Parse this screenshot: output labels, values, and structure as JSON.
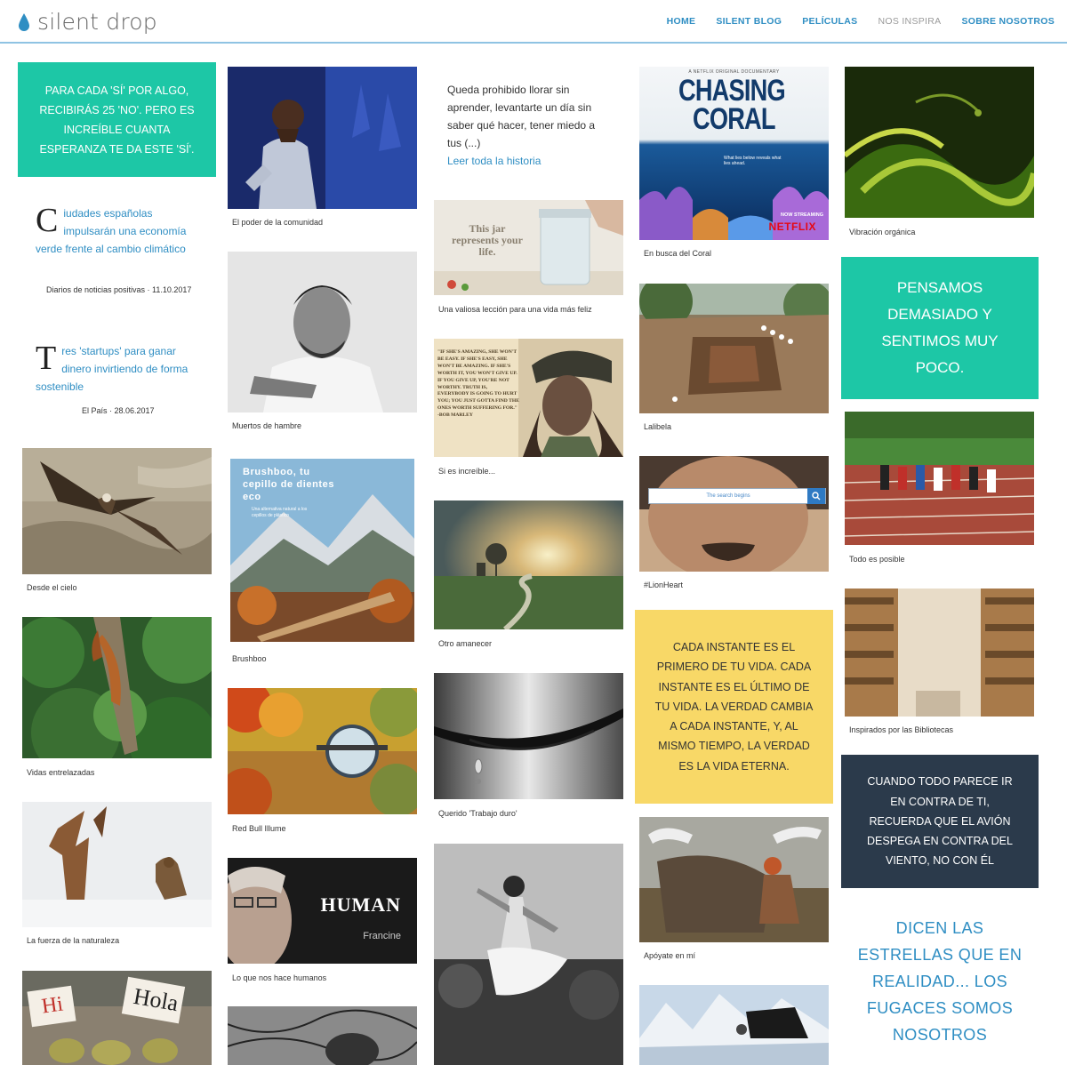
{
  "site": {
    "name": "silent drop"
  },
  "nav": {
    "items": [
      "HOME",
      "SILENT BLOG",
      "PELÍCULAS",
      "NOS INSPIRA",
      "SOBRE NOSOTROS"
    ]
  },
  "colors": {
    "teal": "#1dc7a6",
    "yellow": "#f8d867",
    "navy": "#2b3a4b",
    "link": "#2f8ec3"
  },
  "col1": {
    "quote": "PARA CADA 'SÍ' POR ALGO, RECIBIRÁS 25 'NO'. PERO ES INCREÍBLE CUANTA ESPERANZA TE DA ESTE 'SÍ'.",
    "news1": {
      "cap": "C",
      "rest": "iudades españolas impulsarán una economía verde frente al cambio climático",
      "source": "Diarios de noticias positivas · 11.10.2017"
    },
    "news2": {
      "cap": "T",
      "rest": "res 'startups' para ganar dinero invirtiendo de forma sostenible",
      "source": "El País · 28.06.2017"
    },
    "captions": [
      "Desde el cielo",
      "Vidas entrelazadas",
      "La fuerza de la naturaleza"
    ],
    "sign1": "Hi",
    "sign2": "Hola"
  },
  "col2": {
    "captions": [
      "El poder de la comunidad",
      "Muertos de hambre",
      "Brushboo",
      "Red Bull Illume",
      "Lo que nos hace humanos"
    ],
    "brushboo": {
      "title": "Brushboo, tu cepillo de dientes eco",
      "sub": "Una alternativa natural a los cepillos de plástico"
    },
    "human": {
      "title": "HUMAN",
      "sub": "Francine"
    }
  },
  "col3": {
    "story": "Queda prohibido llorar sin aprender, levantarte un día sin saber qué hacer, tener miedo a tus (...)",
    "story_link": "Leer toda la historia",
    "jar": "This jar represents your life.",
    "marley": "\"IF SHE'S AMAZING, SHE WON'T BE EASY. IF SHE'S EASY, SHE WON'T BE AMAZING. IF SHE'S WORTH IT, YOU WON'T GIVE UP. IF YOU GIVE UP, YOU'RE NOT WORTHY. TRUTH IS, EVERYBODY IS GOING TO HURT YOU; YOU JUST GOTTA FIND THE ONES WORTH SUFFERING FOR.\" -BOB MARLEY",
    "captions": [
      "Una valiosa lección para una vida más feliz",
      "Si es increíble...",
      "Otro amanecer",
      "Querido 'Trabajo duro'"
    ]
  },
  "col4": {
    "coral": {
      "top": "A NETFLIX ORIGINAL DOCUMENTARY",
      "title1": "CHASING",
      "title2": "CORAL",
      "tag": "What lies below reveals what lies ahead.",
      "streaming": "NOW STREAMING",
      "brand": "NETFLIX"
    },
    "search_placeholder": "The search begins",
    "quote": "CADA INSTANTE ES EL PRIMERO DE TU VIDA. CADA INSTANTE ES EL ÚLTIMO DE TU VIDA. LA VERDAD CAMBIA A CADA INSTANTE, Y, AL MISMO TIEMPO, LA VERDAD ES LA VIDA ETERNA.",
    "captions": [
      "En busca del Coral",
      "Lalibela",
      "#LionHeart",
      "Apóyate en mí"
    ]
  },
  "col5": {
    "quote1": "PENSAMOS DEMASIADO Y SENTIMOS MUY POCO.",
    "quote2": "CUANDO TODO PARECE IR EN CONTRA DE TI, RECUERDA QUE EL AVIÓN DESPEGA EN CONTRA DEL VIENTO, NO CON ÉL",
    "quote3": "DICEN LAS ESTRELLAS QUE EN REALIDAD... LOS FUGACES SOMOS NOSOTROS",
    "captions": [
      "Vibración orgánica",
      "Todo es posible",
      "Inspirados por las Bibliotecas"
    ]
  }
}
